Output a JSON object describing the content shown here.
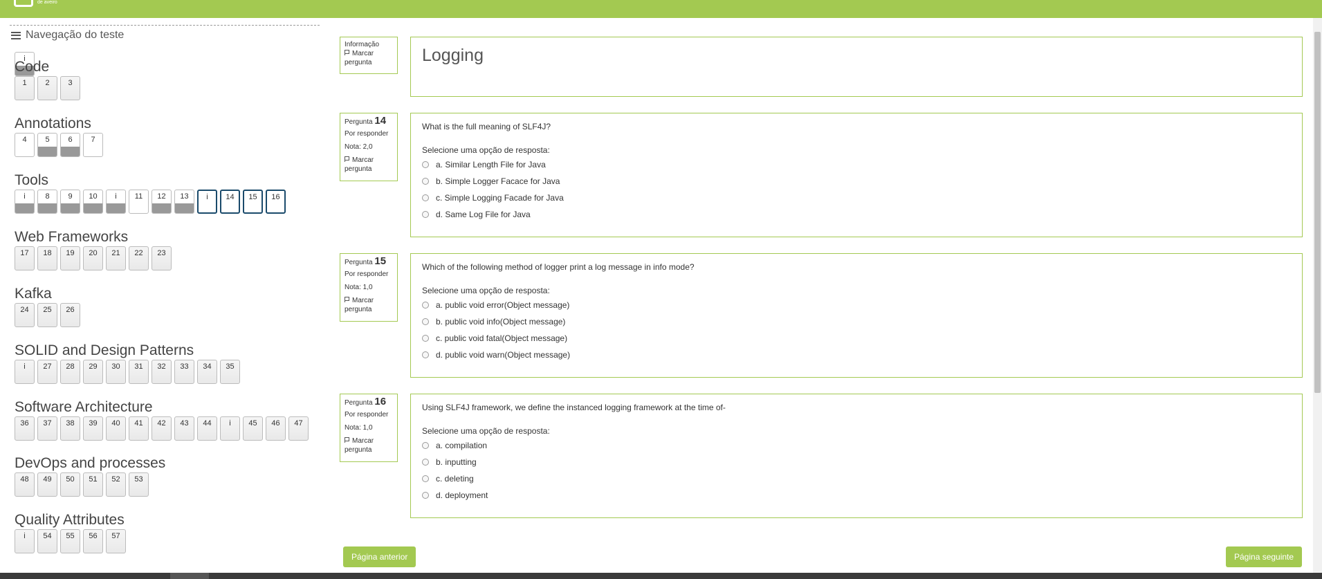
{
  "header": {
    "logo_text": "de aveiro",
    "bar_color": "#a3c951"
  },
  "nav": {
    "title": "Navegação do teste",
    "intro_buttons": [
      {
        "label": "i",
        "state": "answered"
      }
    ],
    "sections": [
      {
        "title": "Code",
        "buttons": [
          {
            "label": "1",
            "state": "partial"
          },
          {
            "label": "2",
            "state": "partial"
          },
          {
            "label": "3",
            "state": "partial"
          }
        ]
      },
      {
        "title": "Annotations",
        "buttons": [
          {
            "label": "4",
            "state": "none"
          },
          {
            "label": "5",
            "state": "answered"
          },
          {
            "label": "6",
            "state": "answered"
          },
          {
            "label": "7",
            "state": "none"
          }
        ]
      },
      {
        "title": "Tools",
        "buttons": [
          {
            "label": "i",
            "state": "answered"
          },
          {
            "label": "8",
            "state": "answered"
          },
          {
            "label": "9",
            "state": "answered"
          },
          {
            "label": "10",
            "state": "answered"
          },
          {
            "label": "i",
            "state": "answered"
          },
          {
            "label": "11",
            "state": "none"
          },
          {
            "label": "12",
            "state": "answered"
          },
          {
            "label": "13",
            "state": "answered"
          },
          {
            "label": "i",
            "state": "current"
          },
          {
            "label": "14",
            "state": "current"
          },
          {
            "label": "15",
            "state": "current"
          },
          {
            "label": "16",
            "state": "current"
          }
        ]
      },
      {
        "title": "Web Frameworks",
        "buttons": [
          {
            "label": "17",
            "state": "partial"
          },
          {
            "label": "18",
            "state": "partial"
          },
          {
            "label": "19",
            "state": "partial"
          },
          {
            "label": "20",
            "state": "partial"
          },
          {
            "label": "21",
            "state": "partial"
          },
          {
            "label": "22",
            "state": "partial"
          },
          {
            "label": "23",
            "state": "partial"
          }
        ]
      },
      {
        "title": "Kafka",
        "buttons": [
          {
            "label": "24",
            "state": "partial"
          },
          {
            "label": "25",
            "state": "partial"
          },
          {
            "label": "26",
            "state": "partial"
          }
        ]
      },
      {
        "title": "SOLID and Design Patterns",
        "buttons": [
          {
            "label": "i",
            "state": "partial"
          },
          {
            "label": "27",
            "state": "partial"
          },
          {
            "label": "28",
            "state": "partial"
          },
          {
            "label": "29",
            "state": "partial"
          },
          {
            "label": "30",
            "state": "partial"
          },
          {
            "label": "31",
            "state": "partial"
          },
          {
            "label": "32",
            "state": "partial"
          },
          {
            "label": "33",
            "state": "partial"
          },
          {
            "label": "34",
            "state": "partial"
          },
          {
            "label": "35",
            "state": "partial"
          }
        ]
      },
      {
        "title": "Software Architecture",
        "buttons": [
          {
            "label": "36",
            "state": "partial"
          },
          {
            "label": "37",
            "state": "partial"
          },
          {
            "label": "38",
            "state": "partial"
          },
          {
            "label": "39",
            "state": "partial"
          },
          {
            "label": "40",
            "state": "partial"
          },
          {
            "label": "41",
            "state": "partial"
          },
          {
            "label": "42",
            "state": "partial"
          },
          {
            "label": "43",
            "state": "partial"
          },
          {
            "label": "44",
            "state": "partial"
          },
          {
            "label": "i",
            "state": "partial"
          },
          {
            "label": "45",
            "state": "partial"
          },
          {
            "label": "46",
            "state": "partial"
          },
          {
            "label": "47",
            "state": "partial"
          }
        ]
      },
      {
        "title": "DevOps and processes",
        "buttons": [
          {
            "label": "48",
            "state": "partial"
          },
          {
            "label": "49",
            "state": "partial"
          },
          {
            "label": "50",
            "state": "partial"
          },
          {
            "label": "51",
            "state": "partial"
          },
          {
            "label": "52",
            "state": "partial"
          },
          {
            "label": "53",
            "state": "partial"
          }
        ]
      },
      {
        "title": "Quality Attributes",
        "buttons": [
          {
            "label": "i",
            "state": "partial"
          },
          {
            "label": "54",
            "state": "partial"
          },
          {
            "label": "55",
            "state": "partial"
          },
          {
            "label": "56",
            "state": "partial"
          },
          {
            "label": "57",
            "state": "partial"
          }
        ]
      }
    ]
  },
  "info_block": {
    "label": "Informação",
    "flag_label": "Marcar pergunta",
    "title": "Logging"
  },
  "questions": [
    {
      "pergunta_label": "Pergunta",
      "number": "14",
      "status": "Por responder",
      "grade": "Nota: 2,0",
      "flag_label": "Marcar pergunta",
      "text": "What is the full meaning of SLF4J?",
      "prompt": "Selecione uma opção de resposta:",
      "options": [
        "a. Similar Length File for Java",
        "b. Simple Logger Facace for Java",
        "c. Simple Logging Facade for Java",
        "d. Same Log File for Java"
      ]
    },
    {
      "pergunta_label": "Pergunta",
      "number": "15",
      "status": "Por responder",
      "grade": "Nota: 1,0",
      "flag_label": "Marcar pergunta",
      "text": "Which of the following method of logger print a log message in info mode?",
      "prompt": "Selecione uma opção de resposta:",
      "options": [
        "a. public void error(Object message)",
        "b. public void info(Object message)",
        "c. public void fatal(Object message)",
        "d. public void warn(Object message)"
      ]
    },
    {
      "pergunta_label": "Pergunta",
      "number": "16",
      "status": "Por responder",
      "grade": "Nota: 1,0",
      "flag_label": "Marcar pergunta",
      "text": "Using SLF4J framework, we define the instanced logging framework at the time of-",
      "prompt": "Selecione uma opção de resposta:",
      "options": [
        "a. compilation",
        "b. inputting",
        "c. deleting",
        "d. deployment"
      ]
    }
  ],
  "footer": {
    "prev_label": "Página anterior",
    "next_label": "Página seguinte"
  }
}
